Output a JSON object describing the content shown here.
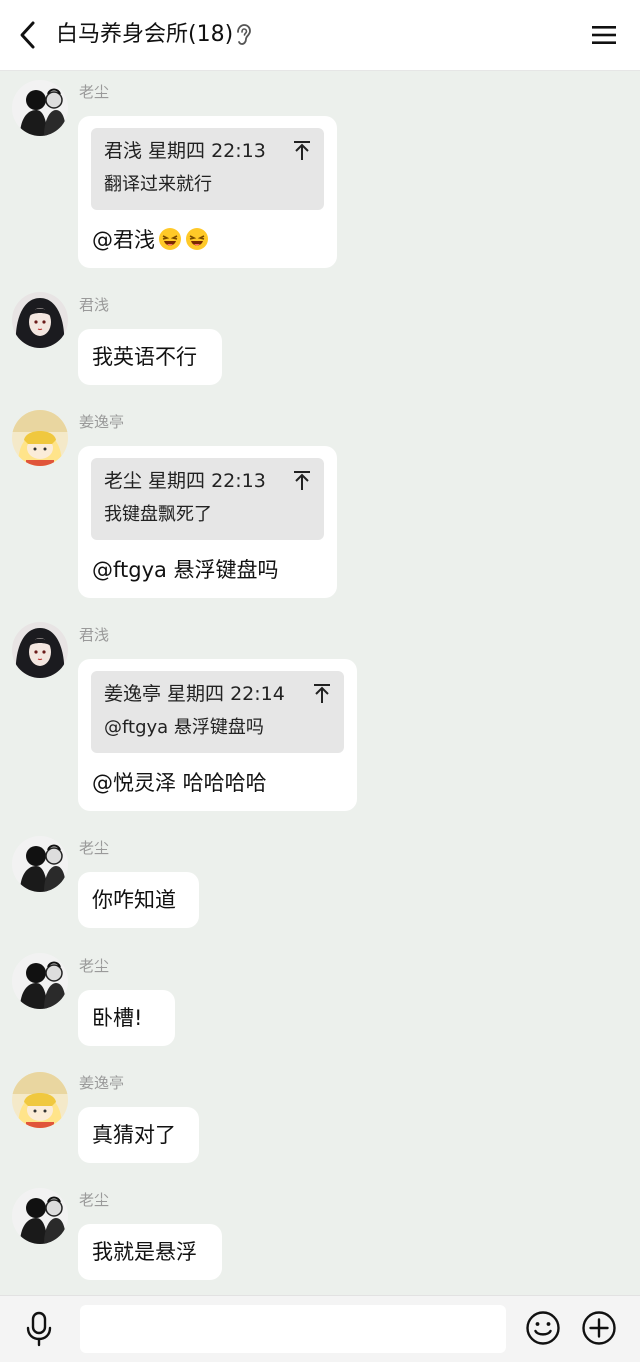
{
  "header": {
    "title": "白马养身会所(18)"
  },
  "messages": [
    {
      "sender": "老尘",
      "quote": {
        "head": "君浅 星期四 22:13",
        "body": "翻译过来就行"
      },
      "text": "@君浅"
    },
    {
      "sender": "君浅",
      "text": "我英语不行"
    },
    {
      "sender": "姜逸亭",
      "quote": {
        "head": "老尘 星期四 22:13",
        "body": "我键盘飘死了"
      },
      "text": "@ftgya 悬浮键盘吗"
    },
    {
      "sender": "君浅",
      "quote": {
        "head": "姜逸亭 星期四 22:14",
        "body": "@ftgya 悬浮键盘吗"
      },
      "text": "@悦灵泽 哈哈哈哈"
    },
    {
      "sender": "老尘",
      "text": "你咋知道"
    },
    {
      "sender": "老尘",
      "text": "卧槽!"
    },
    {
      "sender": "姜逸亭",
      "text": "真猜对了"
    },
    {
      "sender": "老尘",
      "text": "我就是悬浮"
    }
  ],
  "icons": {
    "back": "chevron-left-icon",
    "ear": "ear-icon",
    "menu": "hamburger-menu-icon",
    "mic": "microphone-icon",
    "emoji": "smiley-icon",
    "plus": "plus-circle-icon",
    "jump": "jump-to-original-icon"
  },
  "colors": {
    "background": "#ecf0ec",
    "bubble": "#ffffff",
    "quote": "#e6e6e6",
    "sender": "#9a9a9a"
  }
}
